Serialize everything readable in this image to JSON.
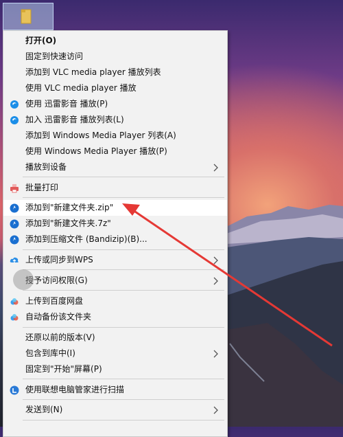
{
  "desktop": {
    "folder_icon": "folder-icon"
  },
  "menu": {
    "items": [
      {
        "label": "打开(O)",
        "bold": true,
        "icon": "",
        "submenu": false
      },
      {
        "label": "固定到快速访问",
        "icon": "",
        "submenu": false
      },
      {
        "label": "添加到 VLC media player 播放列表",
        "icon": "",
        "submenu": false
      },
      {
        "label": "使用 VLC media player 播放",
        "icon": "",
        "submenu": false
      },
      {
        "label": "使用 迅雷影音 播放(P)",
        "icon": "xunlei-icon",
        "submenu": false
      },
      {
        "label": "加入 迅雷影音 播放列表(L)",
        "icon": "xunlei-icon",
        "submenu": false
      },
      {
        "label": "添加到 Windows Media Player 列表(A)",
        "icon": "",
        "submenu": false
      },
      {
        "label": "使用 Windows Media Player 播放(P)",
        "icon": "",
        "submenu": false
      },
      {
        "label": "播放到设备",
        "icon": "",
        "submenu": true
      },
      {
        "label": "批量打印",
        "icon": "printer-icon",
        "submenu": false
      },
      {
        "label": "添加到\"新建文件夹.zip\"",
        "icon": "bandizip-icon",
        "submenu": false
      },
      {
        "label": "添加到\"新建文件夹.7z\"",
        "icon": "bandizip-icon",
        "submenu": false
      },
      {
        "label": "添加到压缩文件 (Bandizip)(B)...",
        "icon": "bandizip-icon",
        "submenu": false
      },
      {
        "label": "上传或同步到WPS",
        "icon": "wps-cloud-icon",
        "submenu": true
      },
      {
        "label": "授予访问权限(G)",
        "icon": "",
        "submenu": true
      },
      {
        "label": "上传到百度网盘",
        "icon": "baidu-netdisk-icon",
        "submenu": false
      },
      {
        "label": "自动备份该文件夹",
        "icon": "baidu-netdisk-icon",
        "submenu": false
      },
      {
        "label": "还原以前的版本(V)",
        "icon": "",
        "submenu": false
      },
      {
        "label": "包含到库中(I)",
        "icon": "",
        "submenu": true
      },
      {
        "label": "固定到\"开始\"屏幕(P)",
        "icon": "",
        "submenu": false
      },
      {
        "label": "使用联想电脑管家进行扫描",
        "icon": "lenovo-shield-icon",
        "submenu": false
      },
      {
        "label": "发送到(N)",
        "icon": "",
        "submenu": true
      }
    ]
  }
}
